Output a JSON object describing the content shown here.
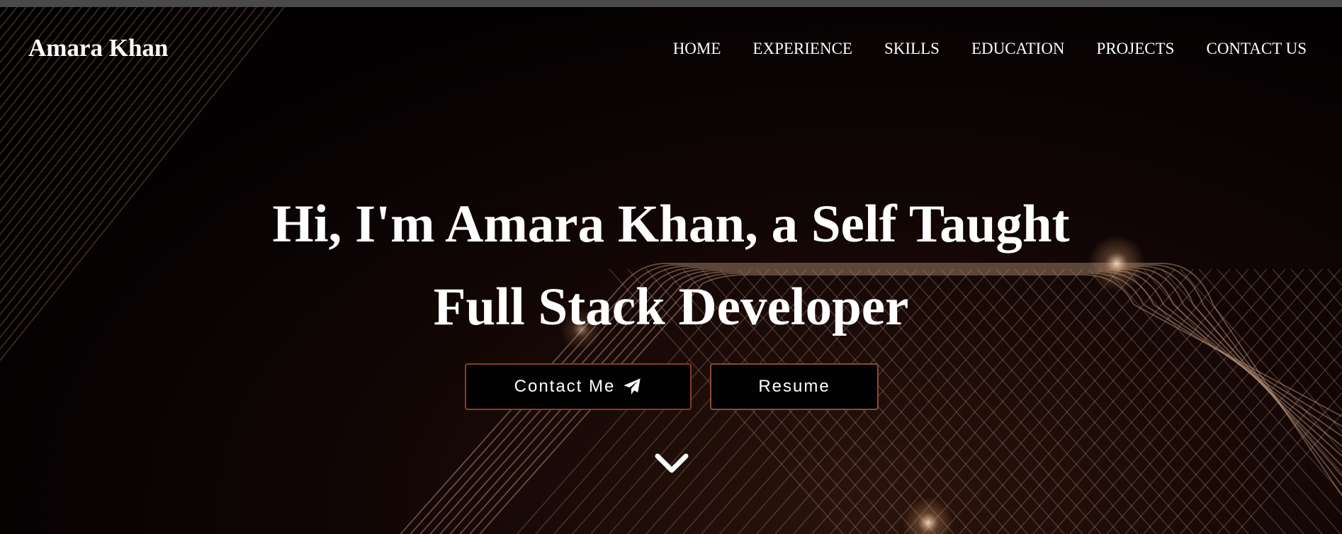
{
  "header": {
    "logo": "Amara Khan",
    "nav": [
      {
        "label": "HOME"
      },
      {
        "label": "EXPERIENCE"
      },
      {
        "label": "SKILLS"
      },
      {
        "label": "EDUCATION"
      },
      {
        "label": "PROJECTS"
      },
      {
        "label": "CONTACT US"
      }
    ]
  },
  "hero": {
    "title_line1": "Hi, I'm Amara Khan, a Self Taught",
    "title_line2": "Full Stack Developer",
    "contact_button": {
      "label": "Contact Me",
      "icon": "paper-plane-icon"
    },
    "resume_button": {
      "label": "Resume"
    },
    "scroll_icon": "chevron-down-icon"
  },
  "colors": {
    "background": "#000000",
    "text": "#ffffff",
    "accent_border": "#8a4a2e",
    "line_art": "#c9a58a"
  }
}
